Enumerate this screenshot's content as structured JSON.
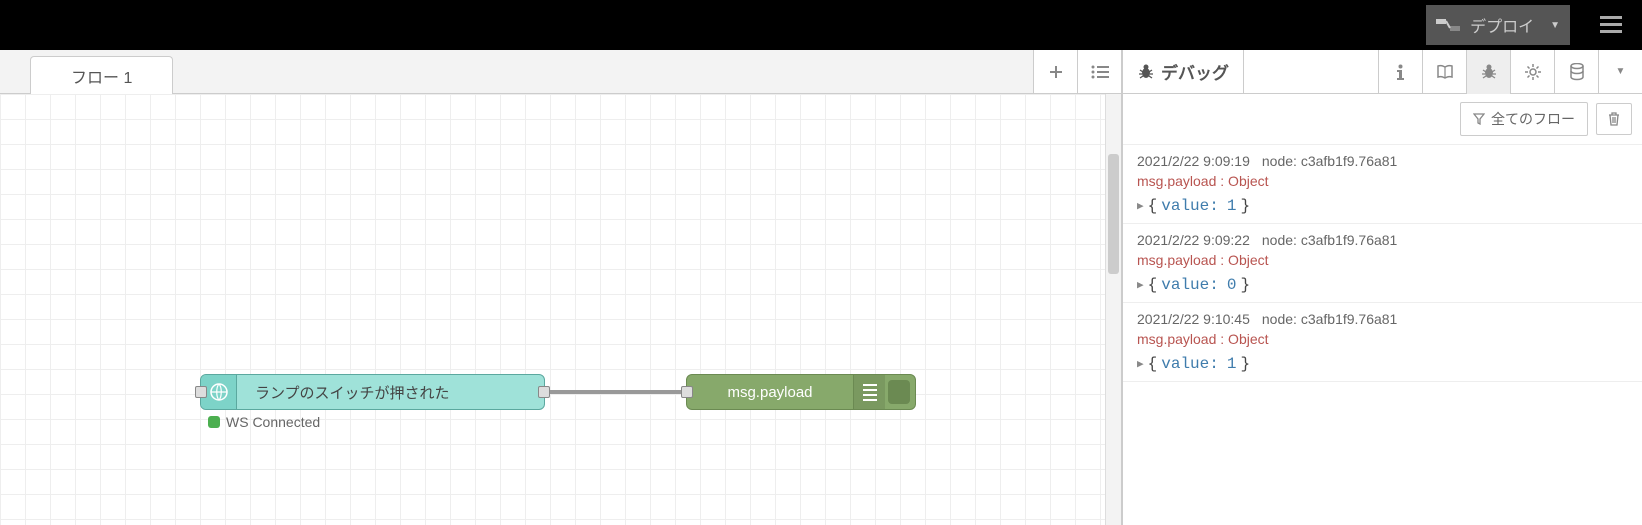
{
  "topbar": {
    "deploy_label": "デプロイ"
  },
  "editor": {
    "tab_label": "フロー 1",
    "node_input": {
      "label": "ランプのスイッチが押された",
      "status": "WS Connected"
    },
    "node_debug": {
      "label": "msg.payload"
    }
  },
  "sidebar": {
    "active_tab_label": "デバッグ",
    "filter_label": "全てのフロー",
    "entries": [
      {
        "ts": "2021/2/22 9:09:19",
        "node": "node: c3afb1f9.76a81",
        "path": "msg.payload : Object",
        "key": "value:",
        "val": "1"
      },
      {
        "ts": "2021/2/22 9:09:22",
        "node": "node: c3afb1f9.76a81",
        "path": "msg.payload : Object",
        "key": "value:",
        "val": "0"
      },
      {
        "ts": "2021/2/22 9:10:45",
        "node": "node: c3afb1f9.76a81",
        "path": "msg.payload : Object",
        "key": "value:",
        "val": "1"
      }
    ]
  }
}
